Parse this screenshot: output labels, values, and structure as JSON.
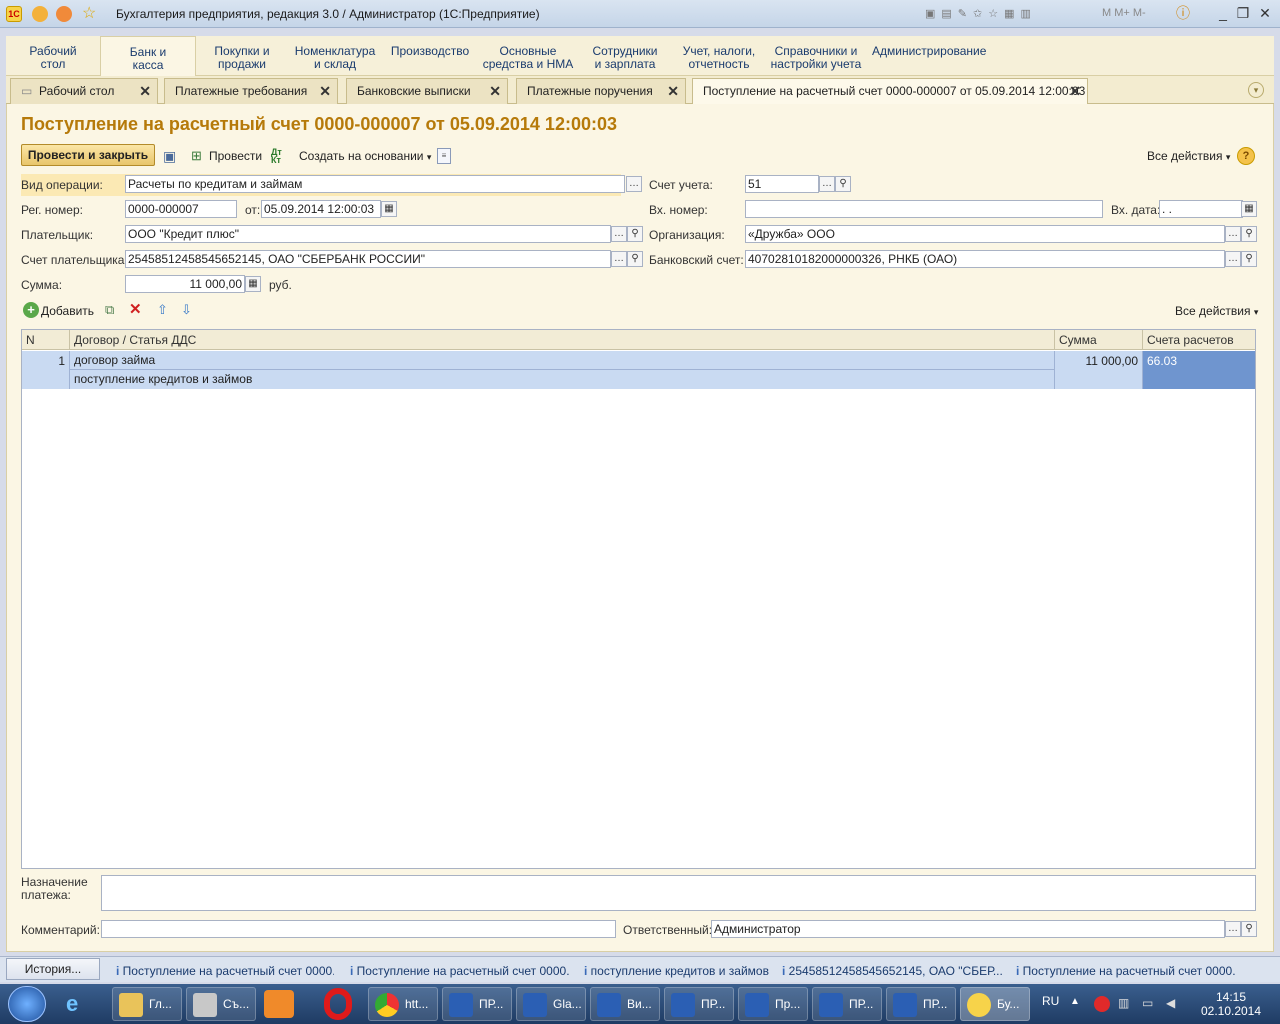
{
  "window": {
    "title": "Бухгалтерия предприятия, редакция 3.0 / Администратор  (1С:Предприятие)"
  },
  "sections": [
    {
      "label": "Рабочий\nстол"
    },
    {
      "label": "Банк и\nкасса"
    },
    {
      "label": "Покупки и\nпродажи"
    },
    {
      "label": "Номенклатура\nи склад"
    },
    {
      "label": "Производство"
    },
    {
      "label": "Основные\nсредства и НМА"
    },
    {
      "label": "Сотрудники\nи зарплата"
    },
    {
      "label": "Учет, налоги,\nотчетность"
    },
    {
      "label": "Справочники и\nнастройки учета"
    },
    {
      "label": "Администрирование"
    }
  ],
  "tabs": [
    {
      "label": "Рабочий стол"
    },
    {
      "label": "Платежные требования"
    },
    {
      "label": "Банковские выписки"
    },
    {
      "label": "Платежные поручения"
    },
    {
      "label": "Поступление на расчетный счет 0000-000007 от 05.09.2014 12:00:03"
    }
  ],
  "form": {
    "title": "Поступление на расчетный счет 0000-000007 от 05.09.2014 12:00:03",
    "toolbar": {
      "post_close": "Провести и закрыть",
      "post": "Провести",
      "create_based": "Создать на основании",
      "all_actions": "Все действия"
    },
    "fields": {
      "op_type_label": "Вид операции:",
      "op_type": "Расчеты по кредитам и займам",
      "account_label": "Счет учета:",
      "account": "51",
      "reg_num_label": "Рег. номер:",
      "reg_num": "0000-000007",
      "from_label": "от:",
      "from_date": "05.09.2014 12:00:03",
      "in_num_label": "Вх. номер:",
      "in_num": "",
      "in_date_label": "Вх. дата:",
      "in_date": " .  .",
      "payer_label": "Плательщик:",
      "payer": "ООО \"Кредит плюс\"",
      "org_label": "Организация:",
      "org": "«Дружба» ООО",
      "payer_acc_label": "Счет плательщика:",
      "payer_acc": "25458512458545652145, ОАО \"СБЕРБАНК РОССИИ\"",
      "bank_acc_label": "Банковский счет:",
      "bank_acc": "40702810182000000326, РНКБ (ОАО)",
      "sum_label": "Сумма:",
      "sum": "11 000,00",
      "currency": "руб."
    },
    "table_toolbar": {
      "add": "Добавить",
      "all_actions": "Все действия"
    },
    "table": {
      "headers": {
        "n": "N",
        "contract": "Договор / Статья ДДС",
        "sum": "Сумма",
        "accounts": "Счета расчетов"
      },
      "rows": [
        {
          "n": "1",
          "contract": "договор займа",
          "article": "поступление кредитов и займов",
          "sum": "11 000,00",
          "account": "66.03"
        }
      ]
    },
    "purpose_label": "Назначение\nплатежа:",
    "purpose": "",
    "comment_label": "Комментарий:",
    "comment": "",
    "responsible_label": "Ответственный:",
    "responsible": "Администратор"
  },
  "history": {
    "button": "История...",
    "items": [
      "Поступление на расчетный счет 0000...",
      "Поступление на расчетный счет 0000...",
      "поступление кредитов и займов",
      "25458512458545652145, ОАО \"СБЕР...",
      "Поступление на расчетный счет 0000..."
    ]
  },
  "taskbar": {
    "items": [
      "Гл...",
      "Съ...",
      "htt...",
      "ПР...",
      "Gla...",
      "Ви...",
      "ПР...",
      "Пр...",
      "ПР...",
      "ПР...",
      "Бу..."
    ],
    "lang": "RU",
    "time": "14:15",
    "date": "02.10.2014"
  }
}
